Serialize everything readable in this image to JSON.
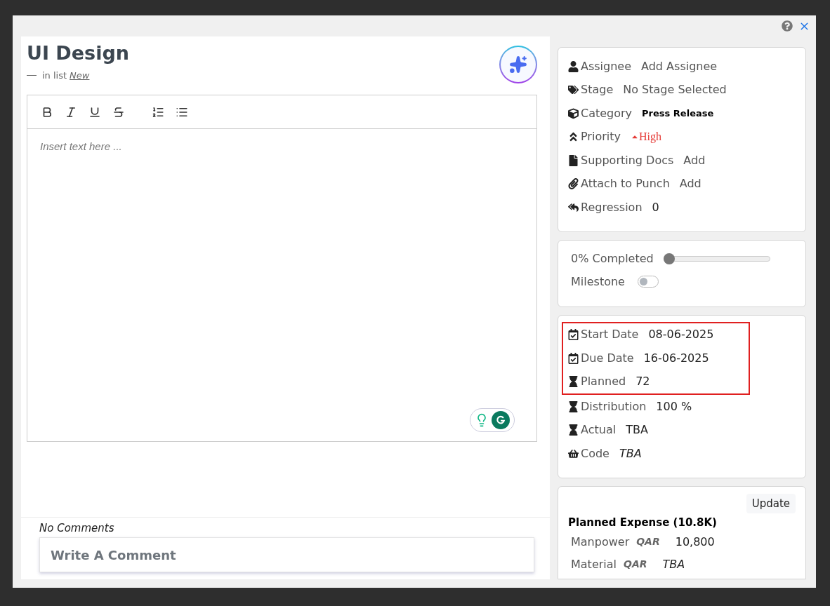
{
  "task": {
    "title": "UI Design",
    "list_prefix": "in list",
    "list_name": "New"
  },
  "editor": {
    "placeholder": "Insert text here ..."
  },
  "comments": {
    "empty_text": "No Comments",
    "placeholder": "Write A Comment"
  },
  "properties": [
    {
      "label": "Assignee",
      "value": "Add Assignee",
      "kind": "plain"
    },
    {
      "label": "Stage",
      "value": "No Stage Selected",
      "kind": "plain"
    },
    {
      "label": "Category",
      "value": "Press Release",
      "kind": "tag"
    },
    {
      "label": "Priority",
      "value": "High",
      "kind": "priority"
    },
    {
      "label": "Supporting Docs",
      "value": "Add",
      "kind": "plain"
    },
    {
      "label": "Attach to Punch",
      "value": "Add",
      "kind": "plain"
    },
    {
      "label": "Regression",
      "value": "0",
      "kind": "number"
    }
  ],
  "progress": {
    "label": "0% Completed",
    "level": 0,
    "milestone_label": "Milestone",
    "milestone_on": false
  },
  "schedule": {
    "highlighted": [
      {
        "label": "Start Date",
        "value": "08-06-2025",
        "kind": "number"
      },
      {
        "label": "Due Date",
        "value": "16-06-2025",
        "kind": "number"
      },
      {
        "label": "Planned",
        "value": "72",
        "kind": "number"
      }
    ],
    "rows": [
      {
        "label": "Distribution",
        "value": "100 %",
        "kind": "number"
      },
      {
        "label": "Actual",
        "value": "TBA",
        "kind": "number"
      },
      {
        "label": "Code",
        "value": "TBA",
        "kind": "italic"
      }
    ]
  },
  "expense": {
    "button": "Update",
    "title": "Planned Expense (10.8K)",
    "rows": [
      {
        "label": "Manpower",
        "currency": "QAR",
        "value": "10,800",
        "kind": "number"
      },
      {
        "label": "Material",
        "currency": "QAR",
        "value": "TBA",
        "kind": "italic"
      }
    ]
  }
}
